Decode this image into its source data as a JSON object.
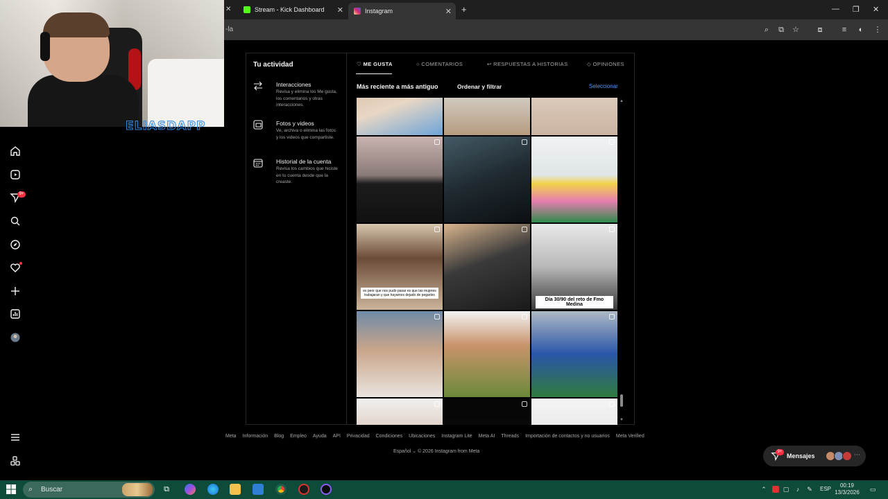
{
  "browser": {
    "tabs": [
      {
        "title": "Stream - Kick Dashboard",
        "favicon_color": "#53fc18"
      },
      {
        "title": "Instagram",
        "favicon_color": "#e1306c",
        "active": true
      }
    ],
    "address_fragment": "-la"
  },
  "webcam": {
    "streamer_name": "ELIASDAPP"
  },
  "ig_nav": {
    "items": [
      "home-icon",
      "reels-icon",
      "messages-icon",
      "search-icon",
      "explore-icon",
      "notifications-icon",
      "create-icon",
      "dashboard-icon",
      "profile-icon"
    ],
    "notif_badge": "9+",
    "bottom_items": [
      "menu-icon",
      "apps-icon"
    ]
  },
  "activity": {
    "title": "Tu actividad",
    "sidebar": [
      {
        "title": "Interacciones",
        "desc": "Revisa y elimina los Me gusta, los comentarios y otras interacciones."
      },
      {
        "title": "Fotos y videos",
        "desc": "Ve, archiva o elimina las fotos y los videos que compartiste."
      },
      {
        "title": "Historial de la cuenta",
        "desc": "Revisa los cambios que hiciste en tu cuenta desde que la creaste."
      }
    ],
    "tabs": [
      "ME GUSTA",
      "COMENTARIOS",
      "RESPUESTAS A HISTORIAS",
      "OPINIONES"
    ],
    "sort_label": "Más reciente a más antiguo",
    "sort_button": "Ordenar y filtrar",
    "select_link": "Seleccionar",
    "grid_captions": {
      "r2c1": "es peor que nos pudo pasar es que las mujeres trabajaran y que hayamos dejado de pegarles",
      "r2c3": "Día 30/90 del reto de Fmo Medina"
    }
  },
  "footer": {
    "links": [
      "Meta",
      "Información",
      "Blog",
      "Empleo",
      "Ayuda",
      "API",
      "Privacidad",
      "Condiciones",
      "Ubicaciones",
      "Instagram Lite",
      "Meta AI",
      "Threads",
      "Importación de contactos y no usuarios",
      "Meta Verified"
    ],
    "language": "Español",
    "copyright": "© 2026 Instagram from Meta"
  },
  "messages": {
    "label": "Mensajes",
    "badge": "9+"
  },
  "taskbar": {
    "search_label": "Buscar",
    "lang": "ESP",
    "time": "00:19",
    "date": "13/3/2026"
  }
}
